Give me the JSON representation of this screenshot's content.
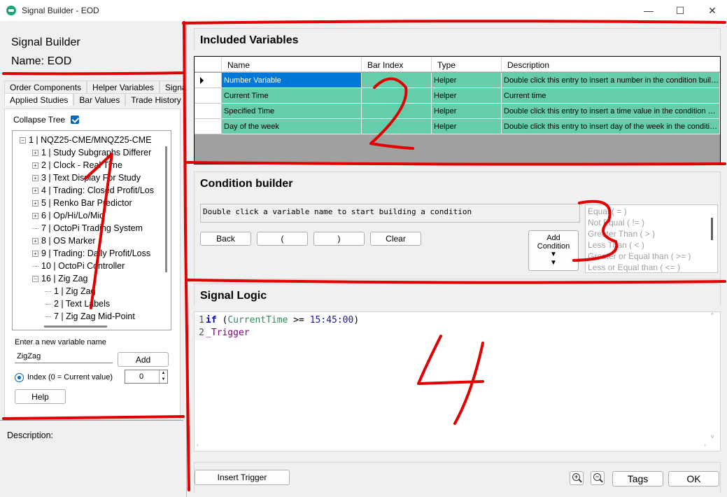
{
  "window": {
    "title": "Signal Builder - EOD",
    "minimize": "—",
    "maximize": "☐",
    "close": "✕"
  },
  "left": {
    "title": "Signal Builder",
    "name": "Name: EOD",
    "tabs_row1": [
      "Order Components",
      "Helper Variables",
      "Signals"
    ],
    "tabs_row2": [
      "Applied Studies",
      "Bar Values",
      "Trade History"
    ],
    "collapse_label": "Collapse Tree",
    "tree": [
      {
        "text": "1 | NQZ25-CME/MNQZ25-CME",
        "toggle": "−",
        "indent": 0
      },
      {
        "text": "1 | Study Subgraphs Differer",
        "toggle": "+",
        "indent": 1
      },
      {
        "text": "2 | Clock - Real Time",
        "toggle": "+",
        "indent": 1
      },
      {
        "text": "3 | Text Display For Study",
        "toggle": "+",
        "indent": 1
      },
      {
        "text": "4 | Trading: Closed Profit/Los",
        "toggle": "+",
        "indent": 1
      },
      {
        "text": "5 | Renko Bar Predictor",
        "toggle": "+",
        "indent": 1
      },
      {
        "text": "6 | Op/Hi/Lo/Mid",
        "toggle": "+",
        "indent": 1
      },
      {
        "text": "7 | OctoPi Trading System",
        "toggle": "",
        "indent": 1
      },
      {
        "text": "8 | OS Marker",
        "toggle": "+",
        "indent": 1
      },
      {
        "text": "9 | Trading: Daily Profit/Loss",
        "toggle": "+",
        "indent": 1
      },
      {
        "text": "10 | OctoPi Controller",
        "toggle": "",
        "indent": 1
      },
      {
        "text": "16 | Zig Zag",
        "toggle": "−",
        "indent": 1
      },
      {
        "text": "1 | Zig Zag",
        "toggle": "",
        "indent": 2
      },
      {
        "text": "2 | Text Labels",
        "toggle": "",
        "indent": 2
      },
      {
        "text": "7 | Zig Zag Mid-Point",
        "toggle": "",
        "indent": 2
      }
    ],
    "var_label": "Enter a new variable name",
    "var_value": "ZigZag",
    "add_button": "Add",
    "index_label": "Index (0 = Current value)",
    "index_value": "0",
    "help_button": "Help",
    "description_label": "Description:"
  },
  "included": {
    "heading": "Included Variables",
    "columns": [
      "Name",
      "Bar Index",
      "Type",
      "Description"
    ],
    "rows": [
      {
        "name": "Number Variable",
        "bar_index": "",
        "type": "Helper",
        "description": "Double click this entry to insert a number in the condition builder"
      },
      {
        "name": "Current Time",
        "bar_index": "",
        "type": "Helper",
        "description": "Current time"
      },
      {
        "name": "Specified Time",
        "bar_index": "",
        "type": "Helper",
        "description": "Double click this entry to insert a time value in the condition bui..."
      },
      {
        "name": "Day of the week",
        "bar_index": "",
        "type": "Helper",
        "description": "Double click this entry to insert day of the week in the conditio..."
      }
    ]
  },
  "condition": {
    "heading": "Condition builder",
    "text": "Double click a variable name to start building a condition",
    "back": "Back",
    "open_paren": "(",
    "close_paren": ")",
    "clear": "Clear",
    "add_condition_1": "Add",
    "add_condition_2": "Condition",
    "operators": [
      "Equal ( = )",
      "Not Equal ( != )",
      "Greater Than ( > )",
      "Less Than ( < )",
      "Greater or Equal than ( >= )",
      "Less or Equal than ( <= )"
    ]
  },
  "logic": {
    "heading": "Signal Logic",
    "lines": [
      {
        "num": "1",
        "kw": "if",
        "open": " (",
        "var": "CurrentTime",
        "op": " >= ",
        "val": "15:45:00",
        "close": ")"
      },
      {
        "num": "2",
        "trigger": "_Trigger"
      }
    ]
  },
  "bottom": {
    "insert_trigger": "Insert Trigger",
    "tags": "Tags",
    "ok": "OK",
    "zoom_in": "+",
    "zoom_out": "−"
  },
  "annotations": [
    "1",
    "2",
    "3",
    "4"
  ],
  "colors": {
    "row_green": "#66cdaa",
    "selection_blue": "#0078d7",
    "annotation_red": "#e00000",
    "keyword_blue": "#0000cc",
    "variable_green": "#2e8b57",
    "trigger_purple": "#800080"
  }
}
